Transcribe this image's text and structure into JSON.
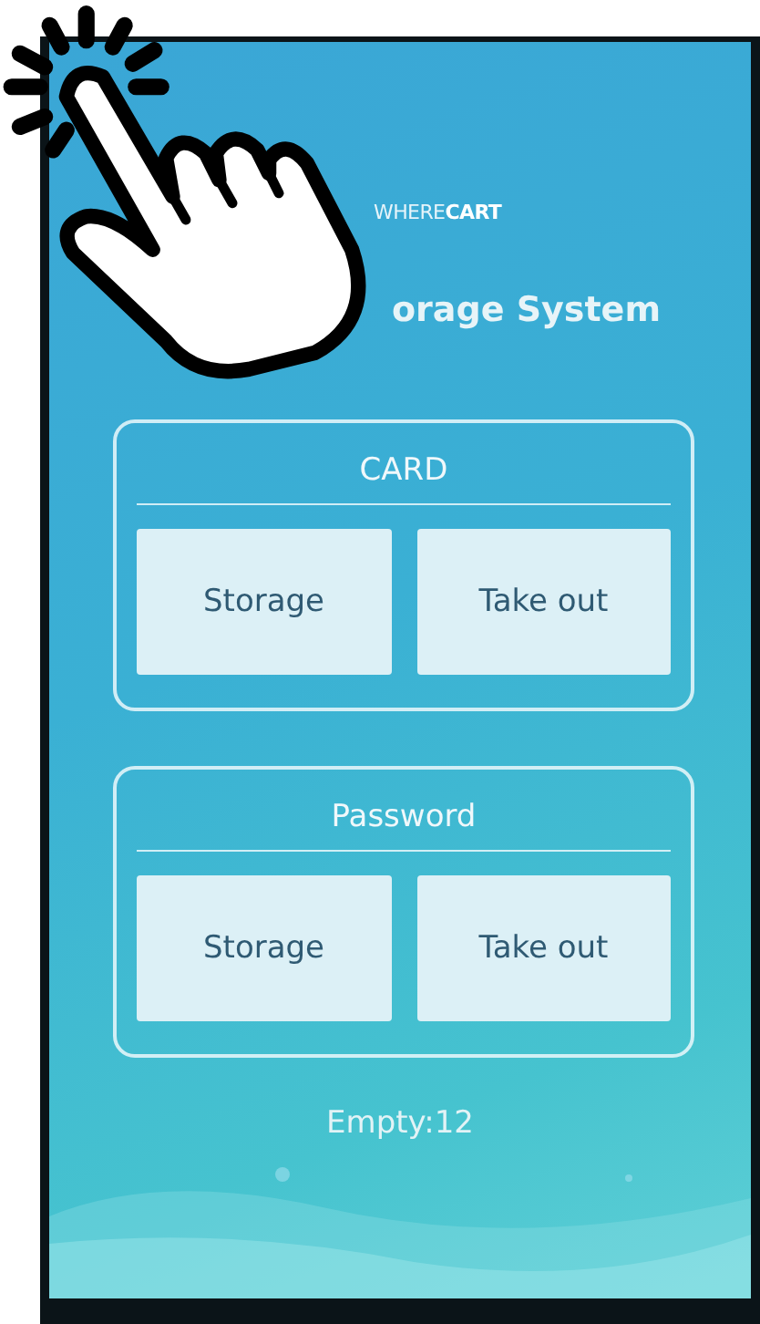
{
  "logo": "WHERE**CART**",
  "title": "orage System",
  "sections": [
    {
      "title": "CARD",
      "buttons": [
        "Storage",
        "Take out"
      ]
    },
    {
      "title": "Password",
      "buttons": [
        "Storage",
        "Take out"
      ]
    }
  ],
  "status": "Empty:12"
}
